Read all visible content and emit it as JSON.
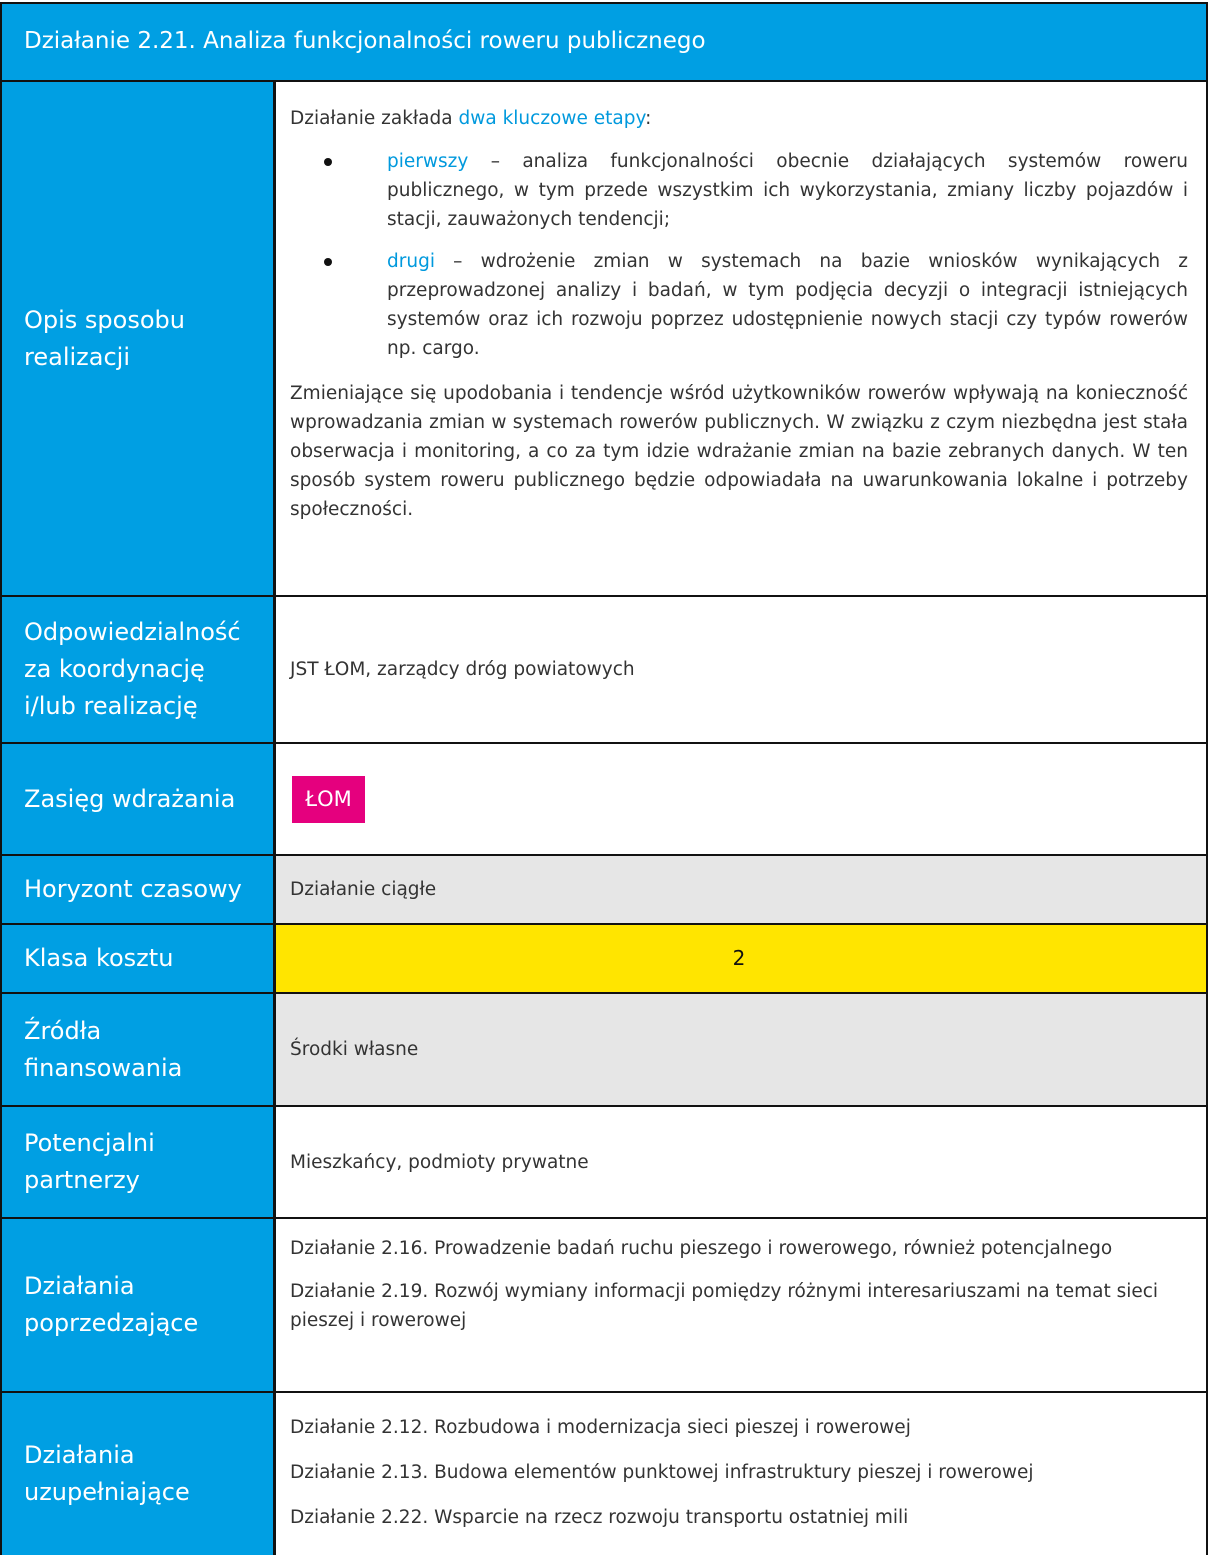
{
  "title": "Działanie 2.21. Analiza funkcjonalności roweru publicznego",
  "rows": {
    "opis": {
      "label": "Opis sposobu realizacji",
      "intro_prefix": "Działanie zakłada ",
      "intro_highlight": "dwa kluczowe etapy",
      "intro_suffix": ":",
      "bullets": [
        {
          "keyword": "pierwszy",
          "text": " – analiza funkcjonalności obecnie działających systemów roweru publicznego, w tym przede wszystkim ich wykorzystania, zmiany liczby pojazdów i stacji, zauważonych tendencji;"
        },
        {
          "keyword": "drugi",
          "text": " – wdrożenie zmian w systemach na bazie wniosków wynikających z przeprowadzonej analizy i badań, w tym podjęcia decyzji o integracji istniejących systemów oraz ich rozwoju poprzez udostępnienie nowych stacji czy typów rowerów np. cargo."
        }
      ],
      "closing": "Zmieniające się upodobania i tendencje wśród użytkowników rowerów wpływają na konieczność wprowadzania zmian w systemach rowerów publicznych. W związku z czym niezbędna jest stała obserwacja i monitoring, a co za tym idzie wdrażanie zmian na bazie zebranych danych. W ten sposób system roweru publicznego będzie odpowiadała na uwarunkowania lokalne i potrzeby społeczności."
    },
    "odpowiedzialnosc": {
      "label": "Odpowiedzialność za koordynację i/lub realizację",
      "value": "JST ŁOM, zarządcy dróg powiatowych"
    },
    "zasieg": {
      "label": "Zasięg wdrażania",
      "badge": "ŁOM",
      "badge_color": "#e5007e"
    },
    "horyzont": {
      "label": "Horyzont czasowy",
      "value": "Działanie ciągłe"
    },
    "klasa": {
      "label": "Klasa kosztu",
      "value": "2",
      "color": "#ffe500"
    },
    "zrodla": {
      "label": "Źródła finansowania",
      "value": "Środki własne"
    },
    "partnerzy": {
      "label": "Potencjalni partnerzy",
      "value": "Mieszkańcy, podmioty prywatne"
    },
    "poprzedzajace": {
      "label": "Działania poprzedzające",
      "items": [
        "Działanie 2.16. Prowadzenie badań ruchu pieszego i rowerowego, również potencjalnego",
        "Działanie 2.19. Rozwój wymiany informacji pomiędzy różnymi interesariuszami na temat sieci pieszej i rowerowej"
      ]
    },
    "uzupelniajace": {
      "label": "Działania uzupełniające",
      "items": [
        "Działanie 2.12. Rozbudowa i modernizacja sieci pieszej i rowerowej",
        "Działanie 2.13. Budowa elementów punktowej infrastruktury pieszej i rowerowej",
        "Działanie 2.22. Wsparcie na rzecz rozwoju transportu ostatniej mili"
      ]
    }
  },
  "colors": {
    "header_blue": "#009fe3",
    "highlight_blue": "#0099dd",
    "gray_cell": "#e6e6e6"
  }
}
